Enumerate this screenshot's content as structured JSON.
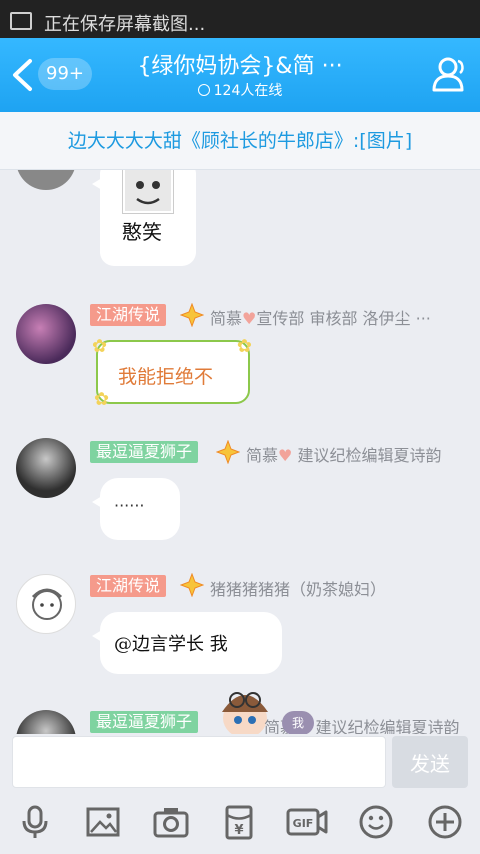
{
  "status_bar": {
    "text": "正在保存屏幕截图..."
  },
  "header": {
    "unread_badge": "99+",
    "title": "{绿你妈协会}&简 ···",
    "online": "124人在线"
  },
  "notice": {
    "text": "边大大大大甜《顾社长的牛郎店》:[图片]"
  },
  "messages": [
    {
      "sticker_text": "憨笑"
    },
    {
      "tag": "江湖传说",
      "name": "简慕",
      "name_rest": "宣传部 审核部 洛伊尘 ···",
      "sticker_text": "我能拒绝不"
    },
    {
      "tag": "最逗逼夏狮子",
      "name": "简慕",
      "name_rest": "建议纪检编辑夏诗韵",
      "text": "······"
    },
    {
      "tag": "江湖传说",
      "name": "猪猪猪猪猪（奶茶媳妇）",
      "text": "@边言学长 我"
    },
    {
      "tag": "最逗逼夏狮子",
      "name": "简慕",
      "name_rest": "建议纪检编辑夏诗韵",
      "overlay_badge": "我"
    }
  ],
  "input": {
    "placeholder": "",
    "value": "",
    "send_label": "发送"
  },
  "toolbar": {
    "icons": [
      "mic-icon",
      "image-icon",
      "camera-icon",
      "red-packet-icon",
      "gif-icon",
      "emoji-icon",
      "plus-icon"
    ]
  },
  "colors": {
    "header": "#1ea3f2",
    "tag_orange": "#f59a8b",
    "tag_green": "#7fd3a0",
    "notice_text": "#1d9ae0"
  }
}
